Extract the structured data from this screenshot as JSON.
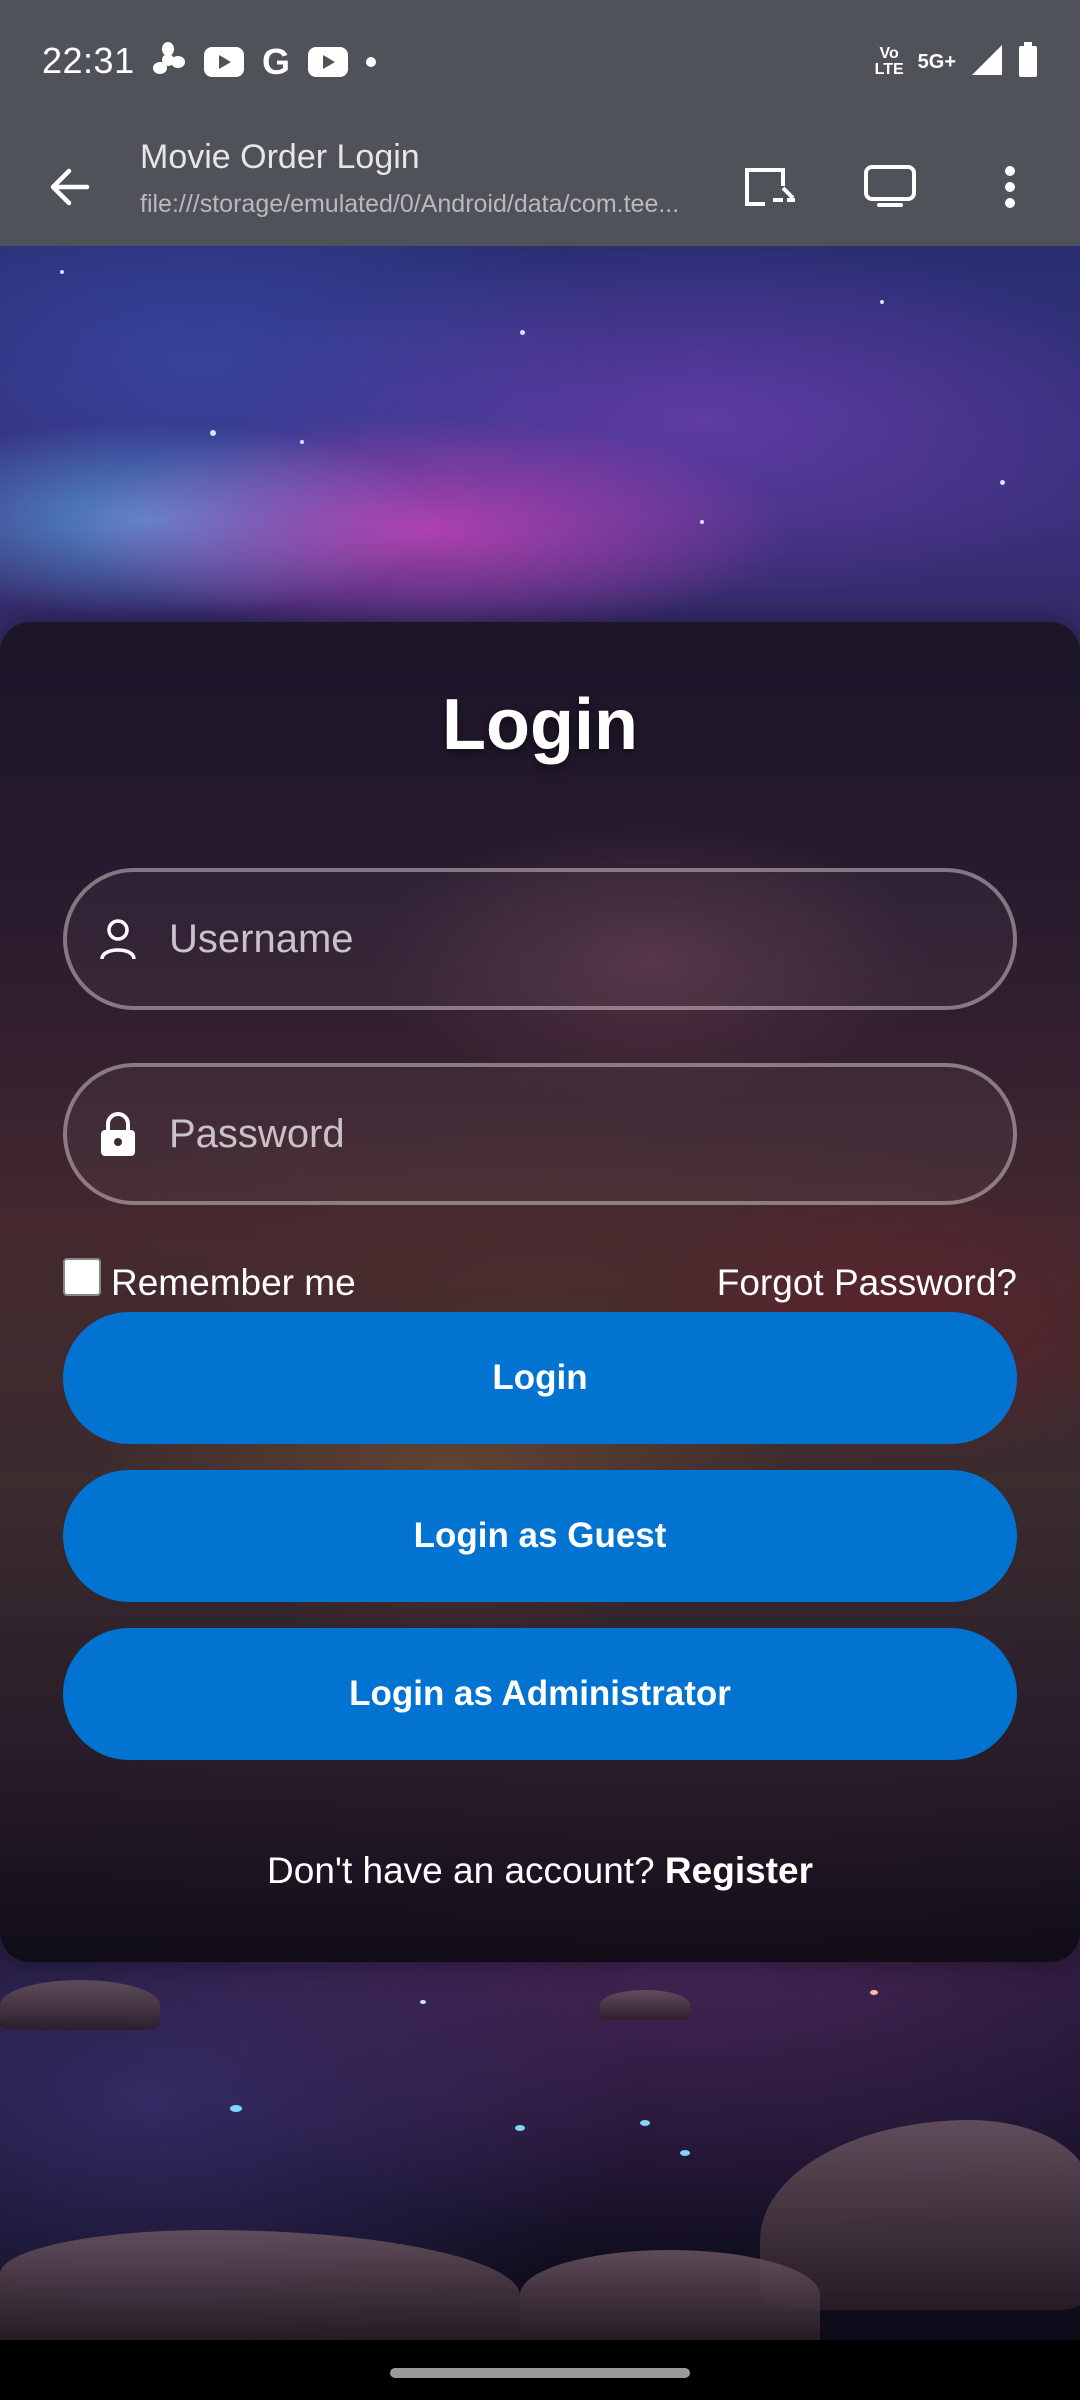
{
  "status_bar": {
    "time": "22:31",
    "notification_icons": [
      "fan-icon",
      "youtube-icon",
      "google-icon",
      "youtube-icon",
      "dot-icon"
    ],
    "network_label_top": "Vo",
    "network_label_bottom": "LTE",
    "network_type": "5G+",
    "signal_icon": "signal-icon",
    "battery_icon": "battery-icon"
  },
  "toolbar": {
    "title": "Movie Order Login",
    "url": "file:///storage/emulated/0/Android/data/com.tee...",
    "icons": [
      "back-arrow-icon",
      "cast-icon",
      "tab-switcher-icon",
      "more-vert-icon"
    ]
  },
  "login": {
    "title": "Login",
    "username_placeholder": "Username",
    "password_placeholder": "Password",
    "remember_label": "Remember me",
    "forgot_label": "Forgot Password?",
    "login_button": "Login",
    "guest_button": "Login as Guest",
    "admin_button": "Login as Administrator",
    "register_prompt": "Don't have an account?",
    "register_link": "Register"
  },
  "colors": {
    "accent": "#0273d0",
    "chrome": "#50525a"
  }
}
